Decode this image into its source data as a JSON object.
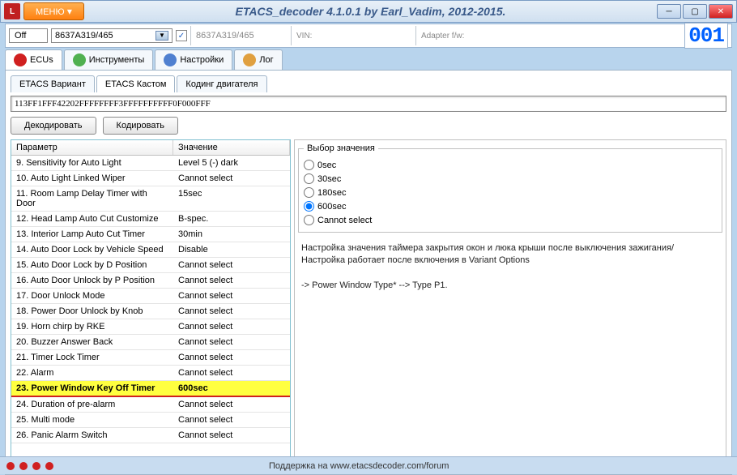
{
  "title": "ETACS_decoder 4.1.0.1 by Earl_Vadim, 2012-2015.",
  "menu_label": "МЕНЮ",
  "infobar": {
    "off": "Off",
    "combo_value": "8637A319/465",
    "checked": "✓",
    "field1": "8637A319/465",
    "vin_label": "VIN:",
    "adapter_label": "Adapter f/w:",
    "counter": "001"
  },
  "maintabs": [
    {
      "label": "ECUs"
    },
    {
      "label": "Инструменты"
    },
    {
      "label": "Настройки"
    },
    {
      "label": "Лог"
    }
  ],
  "subtabs": [
    {
      "label": "ETACS Вариант"
    },
    {
      "label": "ETACS Кастом"
    },
    {
      "label": "Кодинг двигателя"
    }
  ],
  "hex": "113FF1FFF42202FFFFFFFF3FFFFFFFFFF0F000FFF",
  "buttons": {
    "decode": "Декодировать",
    "encode": "Кодировать"
  },
  "table": {
    "h1": "Параметр",
    "h2": "Значение",
    "rows": [
      {
        "p": "9. Sensitivity for Auto Light",
        "v": "Level 5 (-) dark"
      },
      {
        "p": "10. Auto Light Linked Wiper",
        "v": "Cannot select"
      },
      {
        "p": "11. Room Lamp Delay Timer with Door",
        "v": "15sec"
      },
      {
        "p": "12. Head Lamp Auto Cut Customize",
        "v": "B-spec."
      },
      {
        "p": "13. Interior Lamp Auto Cut Timer",
        "v": "30min"
      },
      {
        "p": "14. Auto Door Lock by Vehicle Speed",
        "v": "Disable"
      },
      {
        "p": "15. Auto Door Lock by D Position",
        "v": "Cannot select"
      },
      {
        "p": "16. Auto Door Unlock by P Position",
        "v": "Cannot select"
      },
      {
        "p": "17. Door Unlock Mode",
        "v": "Cannot select"
      },
      {
        "p": "18. Power Door Unlock by Knob",
        "v": "Cannot select"
      },
      {
        "p": "19. Horn chirp by RKE",
        "v": "Cannot select"
      },
      {
        "p": "20. Buzzer Answer Back",
        "v": "Cannot select"
      },
      {
        "p": "21. Timer Lock Timer",
        "v": "Cannot select"
      },
      {
        "p": "22. Alarm",
        "v": "Cannot select"
      },
      {
        "p": "23. Power Window Key Off Timer",
        "v": "600sec",
        "sel": true
      },
      {
        "p": "24. Duration of pre-alarm",
        "v": "Cannot select"
      },
      {
        "p": "25. Multi mode",
        "v": "Cannot select"
      },
      {
        "p": "26. Panic Alarm Switch",
        "v": "Cannot select"
      }
    ]
  },
  "right": {
    "legend": "Выбор значения",
    "options": [
      "0sec",
      "30sec",
      "180sec",
      "600sec",
      "Cannot select"
    ],
    "selected": "600sec",
    "desc1": "Настройка значения таймера закрытия окон и люка крыши после выключения зажигания/",
    "desc2": "Настройка работает после включения в Variant Options",
    "desc3": "-> Power Window Type* --> Type P1."
  },
  "status": {
    "support": "Поддержка на www.etacsdecoder.com/forum"
  }
}
